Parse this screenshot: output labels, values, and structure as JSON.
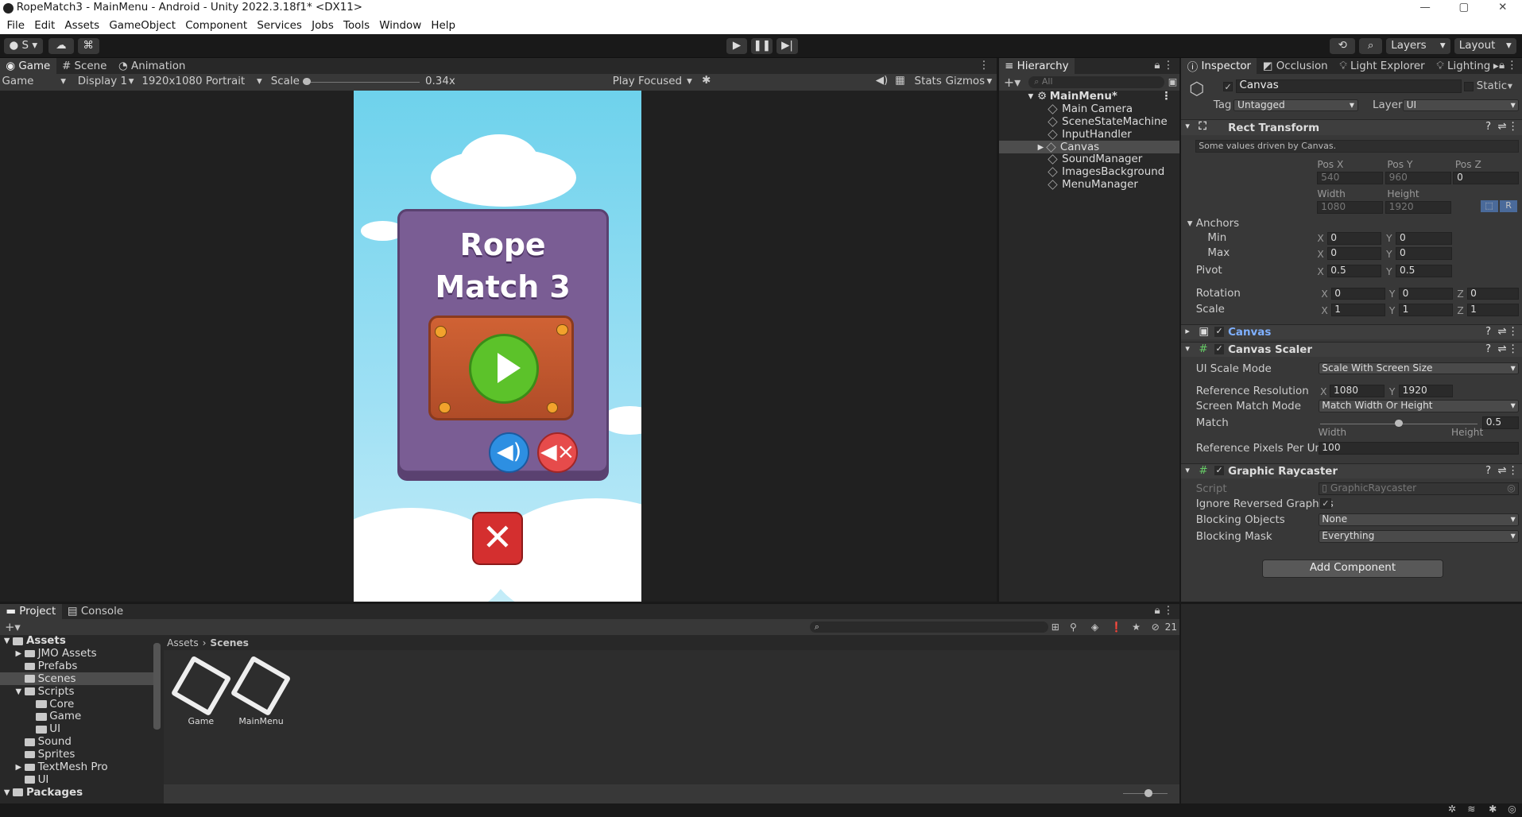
{
  "window": {
    "title": "RopeMatch3 - MainMenu - Android - Unity 2022.3.18f1* <DX11>",
    "min": "—",
    "max": "▢",
    "close": "✕"
  },
  "menu": [
    "File",
    "Edit",
    "Assets",
    "GameObject",
    "Component",
    "Services",
    "Jobs",
    "Tools",
    "Window",
    "Help"
  ],
  "toolbar": {
    "account": "S",
    "layers": "Layers",
    "layout": "Layout"
  },
  "game": {
    "tabs": [
      "Game",
      "Scene",
      "Animation"
    ],
    "display_mode": "Game",
    "display": "Display 1",
    "resolution": "1920x1080 Portrait",
    "scale_label": "Scale",
    "scale_value": "0.34x",
    "play_focused": "Play Focused",
    "stats": "Stats",
    "gizmos": "Gizmos",
    "title_line1": "Rope",
    "title_line2": "Match 3"
  },
  "hierarchy": {
    "tab": "Hierarchy",
    "search_placeholder": "All",
    "root": "MainMenu*",
    "items": [
      "Main Camera",
      "SceneStateMachine",
      "InputHandler",
      "Canvas",
      "SoundManager",
      "ImagesBackground",
      "MenuManager"
    ]
  },
  "inspector": {
    "tabs": [
      "Inspector",
      "Occlusion",
      "Light Explorer",
      "Lighting"
    ],
    "object_name": "Canvas",
    "static_label": "Static",
    "tag_label": "Tag",
    "tag": "Untagged",
    "layer_label": "Layer",
    "layer": "UI",
    "rect": {
      "header": "Rect Transform",
      "note": "Some values driven by Canvas.",
      "posx_label": "Pos X",
      "posy_label": "Pos Y",
      "posz_label": "Pos Z",
      "posx": "540",
      "posy": "960",
      "posz": "0",
      "width_label": "Width",
      "height_label": "Height",
      "width": "1080",
      "height": "1920",
      "anchors": "Anchors",
      "min": "Min",
      "max": "Max",
      "min_x": "0",
      "min_y": "0",
      "max_x": "0",
      "max_y": "0",
      "pivot": "Pivot",
      "pivot_x": "0.5",
      "pivot_y": "0.5",
      "rotation": "Rotation",
      "rot_x": "0",
      "rot_y": "0",
      "rot_z": "0",
      "scale": "Scale",
      "scale_x": "1",
      "scale_y": "1",
      "scale_z": "1"
    },
    "canvas_header": "Canvas",
    "scaler": {
      "header": "Canvas Scaler",
      "ui_scale_mode_label": "UI Scale Mode",
      "ui_scale_mode": "Scale With Screen Size",
      "ref_res_label": "Reference Resolution",
      "ref_x": "1080",
      "ref_y": "1920",
      "match_mode_label": "Screen Match Mode",
      "match_mode": "Match Width Or Height",
      "match_label": "Match",
      "match_value": "0.5",
      "match_fraction": 0.5,
      "width_label": "Width",
      "height_label": "Height",
      "ppu_label": "Reference Pixels Per Unit",
      "ppu": "100"
    },
    "raycaster": {
      "header": "Graphic Raycaster",
      "script_label": "Script",
      "script": "GraphicRaycaster",
      "ignore_label": "Ignore Reversed Graphics",
      "ignore_check": "✓",
      "blocking_objects_label": "Blocking Objects",
      "blocking_objects": "None",
      "blocking_mask_label": "Blocking Mask",
      "blocking_mask": "Everything"
    },
    "add_component": "Add Component"
  },
  "project": {
    "tabs": [
      "Project",
      "Console"
    ],
    "breadcrumb": [
      "Assets",
      "Scenes"
    ],
    "hidden_count": "21",
    "tree": [
      {
        "label": "Assets",
        "depth": 0,
        "bold": true
      },
      {
        "label": "JMO Assets",
        "depth": 1
      },
      {
        "label": "Prefabs",
        "depth": 1
      },
      {
        "label": "Scenes",
        "depth": 1,
        "selected": true
      },
      {
        "label": "Scripts",
        "depth": 1
      },
      {
        "label": "Core",
        "depth": 2
      },
      {
        "label": "Game",
        "depth": 2
      },
      {
        "label": "UI",
        "depth": 2
      },
      {
        "label": "Sound",
        "depth": 1
      },
      {
        "label": "Sprites",
        "depth": 1
      },
      {
        "label": "TextMesh Pro",
        "depth": 1
      },
      {
        "label": "UI",
        "depth": 1
      },
      {
        "label": "Packages",
        "depth": 0,
        "bold": true
      }
    ],
    "assets": [
      "Game",
      "MainMenu"
    ]
  }
}
